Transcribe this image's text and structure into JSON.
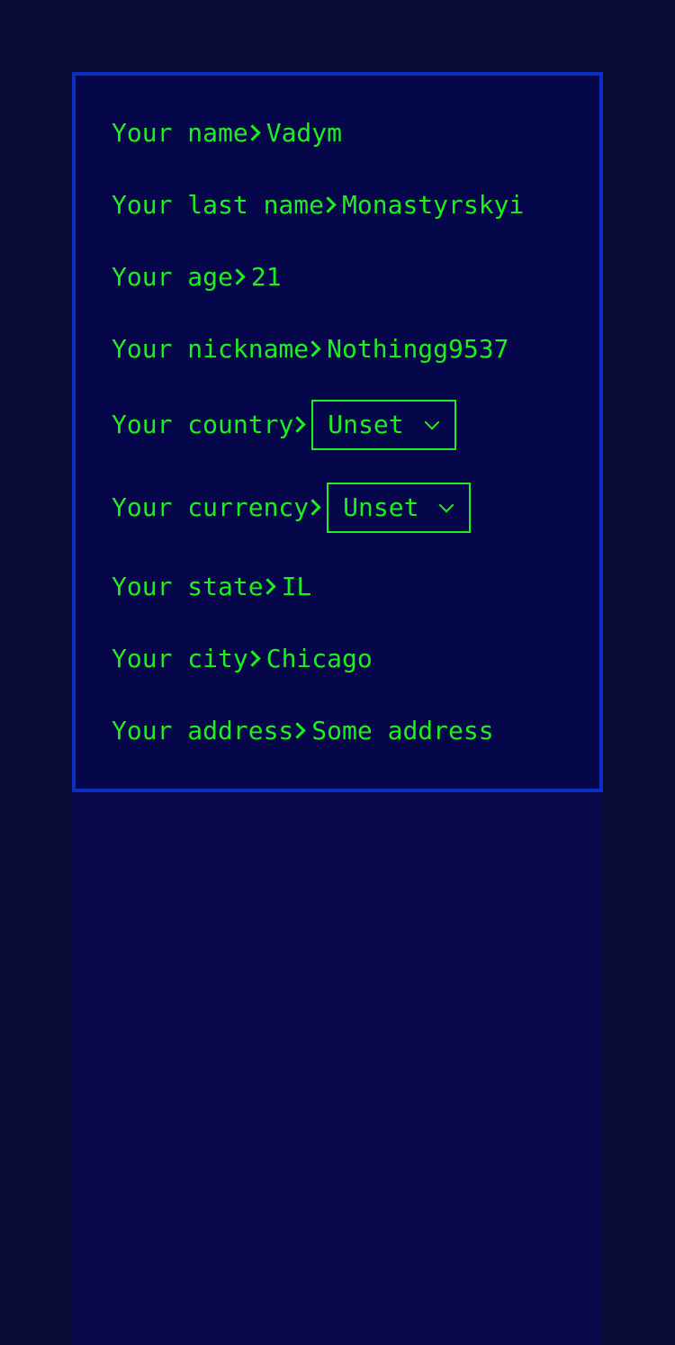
{
  "colors": {
    "background": "#070b35",
    "panel": "#06064a",
    "panel_border": "#0a2fc2",
    "text": "#1ef01e"
  },
  "fields": {
    "name": {
      "label": "Your name",
      "value": "Vadym"
    },
    "last_name": {
      "label": "Your last name",
      "value": "Monastyrskyi"
    },
    "age": {
      "label": "Your age",
      "value": "21"
    },
    "nickname": {
      "label": "Your nickname",
      "value": "Nothingg9537"
    },
    "country": {
      "label": "Your country",
      "value": "Unset"
    },
    "currency": {
      "label": "Your currency",
      "value": "Unset"
    },
    "state": {
      "label": "Your state",
      "value": "IL"
    },
    "city": {
      "label": "Your city",
      "value": "Chicago"
    },
    "address": {
      "label": "Your address",
      "value": "Some address"
    }
  }
}
